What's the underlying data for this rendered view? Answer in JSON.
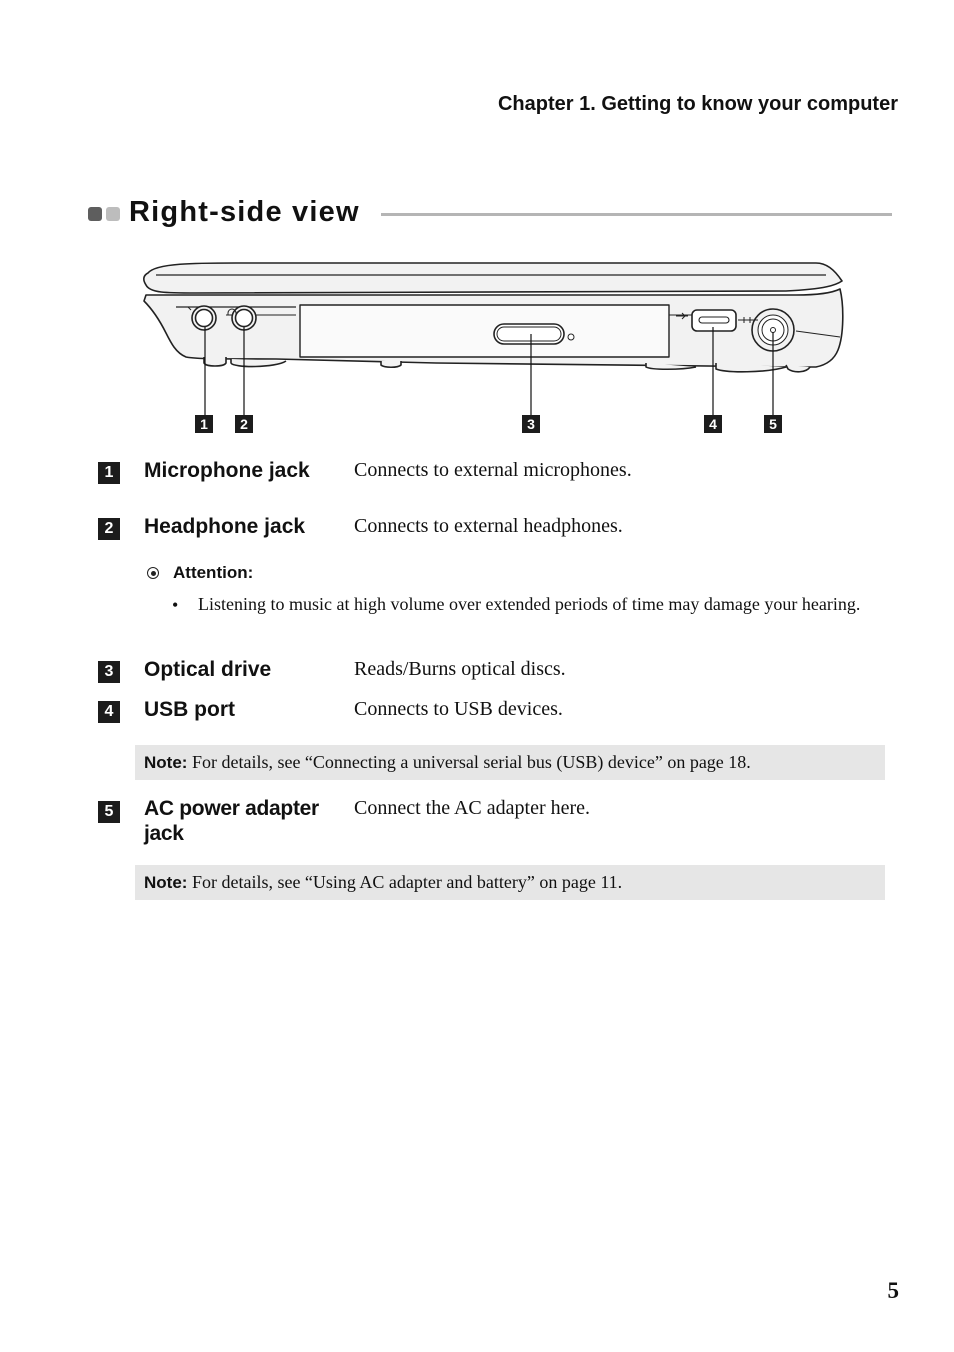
{
  "header": {
    "chapter": "Chapter 1. Getting to know your computer"
  },
  "section": {
    "title": "Right-side view"
  },
  "diagram": {
    "description": "Right side of laptop showing ports",
    "callouts": [
      "1",
      "2",
      "3",
      "4",
      "5"
    ],
    "icons": [
      "microphone-icon",
      "headphone-icon",
      "usb-icon",
      "dc-power-icon"
    ]
  },
  "items": [
    {
      "number": "1",
      "name": "Microphone jack",
      "description": "Connects to external microphones."
    },
    {
      "number": "2",
      "name": "Headphone jack",
      "description": "Connects to external headphones."
    },
    {
      "number": "3",
      "name": "Optical drive",
      "description": "Reads/Burns optical discs."
    },
    {
      "number": "4",
      "name": "USB port",
      "description": "Connects to USB devices."
    },
    {
      "number": "5",
      "name": "AC power adapter jack",
      "description": "Connect the AC adapter here."
    }
  ],
  "attention": {
    "label": "Attention:",
    "bullets": [
      "Listening to music at high volume over extended periods of time may damage your hearing."
    ]
  },
  "notes": [
    {
      "label": "Note:",
      "text": " For details, see “Connecting a universal serial bus (USB) device” on page 18."
    },
    {
      "label": "Note:",
      "text": " For details, see “Using AC adapter and battery” on page 11."
    }
  ],
  "footer": {
    "page_number": "5"
  }
}
